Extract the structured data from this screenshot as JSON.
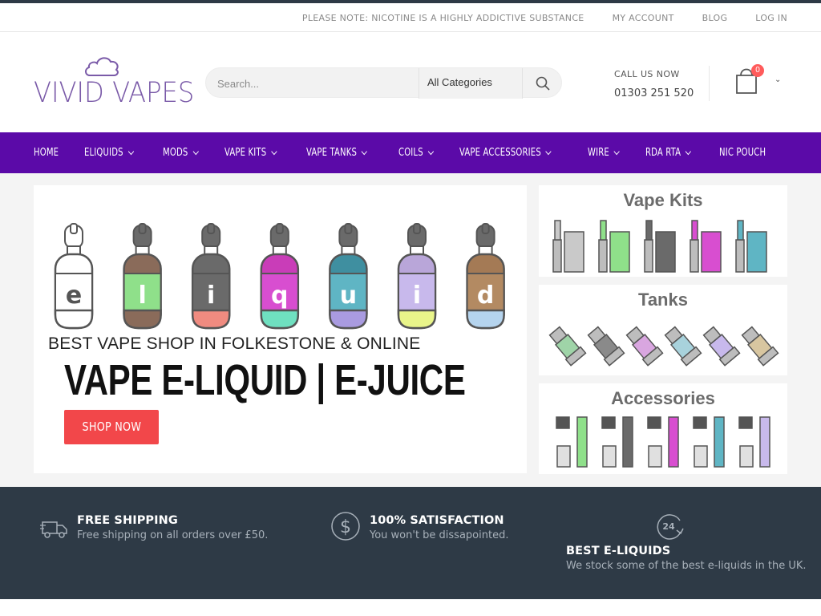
{
  "topbar": {
    "notice": "PLEASE NOTE: NICOTINE IS A HIGHLY ADDICTIVE SUBSTANCE",
    "my_account": "MY ACCOUNT",
    "blog": "BLOG",
    "login": "LOG IN"
  },
  "logo": {
    "text": "VIVID VAPES",
    "color": "#7a5aa8"
  },
  "search": {
    "placeholder": "Search...",
    "category": "All Categories"
  },
  "contact": {
    "label": "CALL US NOW",
    "phone": "01303 251 520"
  },
  "cart": {
    "count": "0"
  },
  "nav": {
    "items": [
      {
        "label": "HOME"
      },
      {
        "label": "ELIQUIDS"
      },
      {
        "label": "MODS"
      },
      {
        "label": "VAPE KITS"
      },
      {
        "label": "VAPE TANKS"
      },
      {
        "label": "COILS"
      },
      {
        "label": "VAPE ACCESSORIES"
      },
      {
        "label": "WIRE"
      },
      {
        "label": "RDA RTA"
      },
      {
        "label": "NIC POUCH"
      }
    ]
  },
  "hero": {
    "letters": [
      "e",
      "l",
      "i",
      "q",
      "u",
      "i",
      "d"
    ],
    "subtitle": "BEST VAPE SHOP IN FOLKESTONE & ONLINE",
    "title": "VAPE E-LIQUID | E-JUICE",
    "button": "SHOP NOW"
  },
  "banners": {
    "kits": "Vape Kits",
    "tanks": "Tanks",
    "accessories": "Accessories"
  },
  "features": {
    "shipping": {
      "title": "FREE SHIPPING",
      "desc": "Free shipping on all orders over £50."
    },
    "satisfaction": {
      "title": "100% SATISFACTION",
      "desc": "You won't be dissapointed."
    },
    "eliquids": {
      "title": "BEST E-LIQUIDS",
      "desc": "We stock some of the best e-liquids in the UK.",
      "icon_text": "24"
    }
  },
  "colors": {
    "nav_bg": "#5b0aa8",
    "accent": "#f2474a",
    "footer_bg": "#2e3a46",
    "bottle_body": [
      "#ffffff",
      "#8a6b5a",
      "#6a6a6a",
      "#c93db8",
      "#3f8fa0",
      "#b9a6d9",
      "#a47a55"
    ],
    "bottle_label": [
      "#ffffff",
      "#8fe08a",
      "#6a6a6a",
      "#d84ed0",
      "#5fb5c4",
      "#c8b9ec",
      "#b38a62"
    ],
    "bottle_base": [
      "#ffffff",
      "#8a6b5a",
      "#f08b80",
      "#6fe0c0",
      "#a99be0",
      "#e9f58a",
      "#b5d4ee"
    ]
  }
}
